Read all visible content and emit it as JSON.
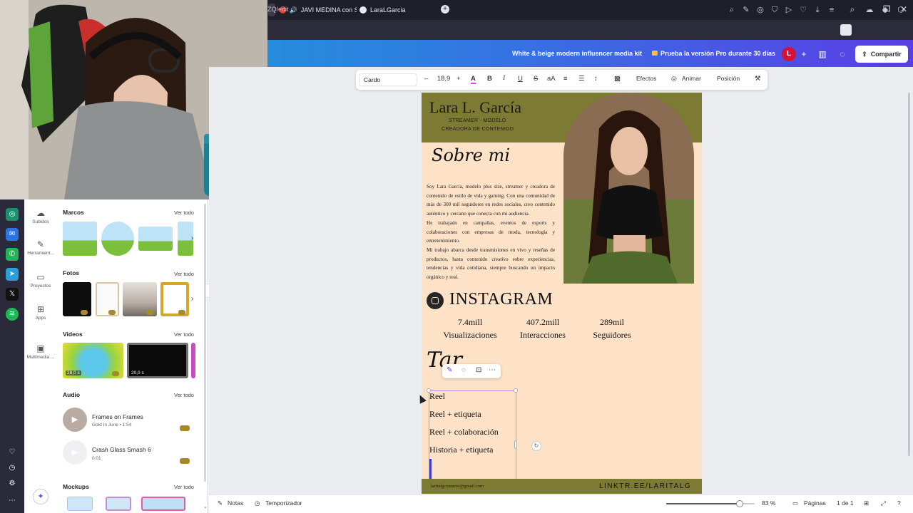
{
  "browser": {
    "tabs": [
      {
        "label": "JAVI MEDINA con SAL",
        "icon": "youtube-icon"
      },
      {
        "label": "LaraLGarcia",
        "icon": "canva-icon"
      }
    ],
    "new_tab": "+",
    "url": "ZQ/edit"
  },
  "header": {
    "doc_title": "White & beige modern influencer media kit",
    "pro_button": "Prueba la versión Pro durante 30 días",
    "avatar_initial": "L",
    "share_button": "Compartir",
    "accent": "#5a3ee6"
  },
  "text_toolbar": {
    "font": "Cardo",
    "font_size": "18,9",
    "effects": "Efectos",
    "animate": "Animar",
    "position": "Posición"
  },
  "nav": {
    "items": [
      {
        "label": "Subidos",
        "icon": "upload-cloud-icon"
      },
      {
        "label": "Herramient...",
        "icon": "pen-icon"
      },
      {
        "label": "Proyectos",
        "icon": "folder-icon"
      },
      {
        "label": "Apps",
        "icon": "apps-grid-icon"
      },
      {
        "label": "Multimedia ...",
        "icon": "image-icon"
      }
    ]
  },
  "panel": {
    "sections": [
      {
        "title": "Marcos",
        "see_all": "Ver todo"
      },
      {
        "title": "Fotos",
        "see_all": "Ver todo"
      },
      {
        "title": "Videos",
        "see_all": "Ver todo"
      },
      {
        "title": "Audio",
        "see_all": "Ver todo"
      },
      {
        "title": "Mockups",
        "see_all": "Ver todo"
      }
    ],
    "videos": [
      {
        "duration": "28,0 s"
      },
      {
        "duration": "20,0 s"
      }
    ],
    "audio": [
      {
        "title": "Frames on Frames",
        "meta": "Gold In June • 1:54"
      },
      {
        "title": "Crash Glass Smash 6",
        "meta": "0:01"
      }
    ]
  },
  "page": {
    "name": "Lara L. García",
    "subtitle_1": "STREAMER - MODELO",
    "subtitle_2": "CREADORA DE CONTENIDO",
    "about_title": "Sobre mi",
    "about_p1": "Soy Lara García, modelo plus size, streamer y creadora de contenido de estilo de vida y gaming. Con una comunidad de más de 300 mil seguidores en redes sociales, creo contenido auténtico y cercano que conecta con mi audiencia.",
    "about_p2": "He trabajado en campañas, eventos de esports y colaboraciones con empresas de moda, tecnología y entretenimiento.",
    "about_p3": "Mi trabajo abarca desde transmisiones en vivo y reseñas de productos, hasta contenido creativo sobre experiencias, tendencias y vida cotidiana, siempre buscando un impacto orgánico y real.",
    "instagram_title": "INSTAGRAM",
    "stats": [
      {
        "value": "7.4mill",
        "label": "Visualizaciones"
      },
      {
        "value": "407.2mill",
        "label": "Interacciones"
      },
      {
        "value": "289mil",
        "label": "Seguidores"
      }
    ],
    "rates_title": "Tar",
    "rates": [
      "Reel",
      "Reel + etiqueta",
      "Reel + colaboración",
      "Historia + etiqueta"
    ],
    "email": "laritalgcontacto@gmail.com",
    "link": "LINKTR.EE/LARITALG"
  },
  "status": {
    "notes": "Notas",
    "timer": "Temporizador",
    "zoom": "83 %",
    "zoom_level": 0.83,
    "pages_label": "Páginas",
    "page_count": "1 de 1"
  }
}
